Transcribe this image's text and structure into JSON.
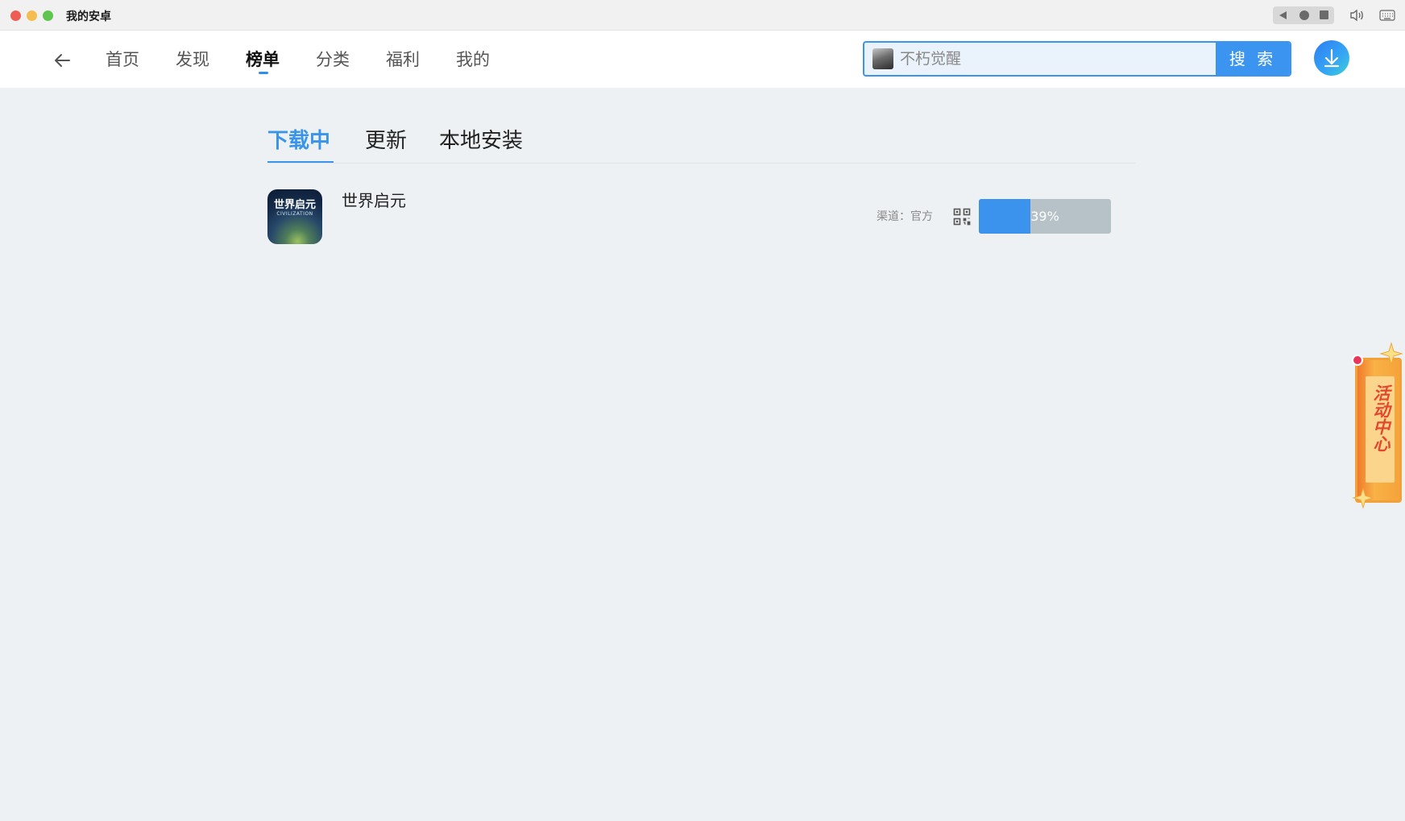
{
  "window": {
    "title": "我的安卓"
  },
  "nav": {
    "items": [
      "首页",
      "发现",
      "榜单",
      "分类",
      "福利",
      "我的"
    ],
    "active_index": 2
  },
  "search": {
    "placeholder": "不朽觉醒",
    "button_label": "搜 索"
  },
  "tabs": {
    "items": [
      "下载中",
      "更新",
      "本地安装"
    ],
    "active_index": 0
  },
  "downloads": [
    {
      "name": "世界启元",
      "icon_text": "世界启元",
      "icon_subtext": "CIVILIZATION",
      "channel": "渠道：官方",
      "progress": 39,
      "progress_text": "39%"
    }
  ],
  "activity_center": {
    "label": "活动中心"
  },
  "colors": {
    "accent": "#3b95f0",
    "background": "#edf1f4",
    "progress_track": "#b7c2c8",
    "activity_orange": "#f6a33b"
  },
  "icons": [
    "back-arrow-icon",
    "download-icon",
    "qr-code-icon",
    "volume-icon",
    "keyboard-icon"
  ]
}
